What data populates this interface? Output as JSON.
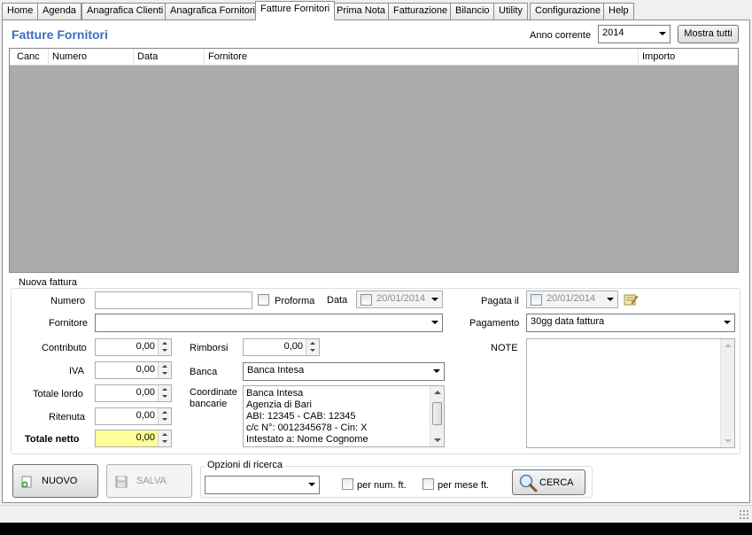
{
  "tabs": [
    {
      "label": "Home"
    },
    {
      "label": "Agenda"
    },
    {
      "label": "Anagrafica Clienti"
    },
    {
      "label": "Anagrafica Fornitori"
    },
    {
      "label": "Fatture Fornitori",
      "active": true
    },
    {
      "label": "Prima Nota"
    },
    {
      "label": "Fatturazione"
    },
    {
      "label": "Bilancio"
    },
    {
      "label": "Utility"
    },
    {
      "label": "Configurazione"
    },
    {
      "label": "Help"
    }
  ],
  "header": {
    "title": "Fatture Fornitori",
    "year_label": "Anno corrente",
    "year_value": "2014",
    "show_all_label": "Mostra tutti"
  },
  "grid": {
    "columns": [
      "Canc",
      "Numero",
      "Data",
      "Fornitore",
      "Importo"
    ],
    "rows": []
  },
  "form": {
    "group_label": "Nuova fattura",
    "numero_label": "Numero",
    "numero_value": "",
    "proforma_label": "Proforma",
    "data_label": "Data",
    "data_value": "20/01/2014",
    "pagata_label": "Pagata il",
    "pagata_value": "20/01/2014",
    "fornitore_label": "Fornitore",
    "fornitore_value": "",
    "pagamento_label": "Pagamento",
    "pagamento_value": "30gg data fattura",
    "contributo_label": "Contributo",
    "contributo_value": "0,00",
    "iva_label": "IVA",
    "iva_value": "0,00",
    "totale_lordo_label": "Totale lordo",
    "totale_lordo_value": "0,00",
    "ritenuta_label": "Ritenuta",
    "ritenuta_value": "0,00",
    "totale_netto_label": "Totale netto",
    "totale_netto_value": "0,00",
    "rimborsi_label": "Rimborsi",
    "rimborsi_value": "0,00",
    "banca_label": "Banca",
    "banca_value": "Banca Intesa",
    "coordinate_label_1": "Coordinate",
    "coordinate_label_2": "bancarie",
    "coordinate_lines": [
      "Banca Intesa",
      "Agenzia di Bari",
      "ABI: 12345 - CAB: 12345",
      "c/c N°: 0012345678 - Cin: X",
      "Intestato a: Nome Cognome"
    ],
    "note_label": "NOTE",
    "note_value": ""
  },
  "actions": {
    "nuovo_label": "NUOVO",
    "salva_label": "SALVA"
  },
  "search": {
    "group_label": "Opzioni di ricerca",
    "combo_value": "",
    "per_num_label": "per num. ft.",
    "per_mese_label": "per mese ft.",
    "cerca_label": "CERCA"
  },
  "colors": {
    "title": "#3a6fc4",
    "grid_background": "#ababab",
    "totale_netto_background": "#ffff99"
  }
}
